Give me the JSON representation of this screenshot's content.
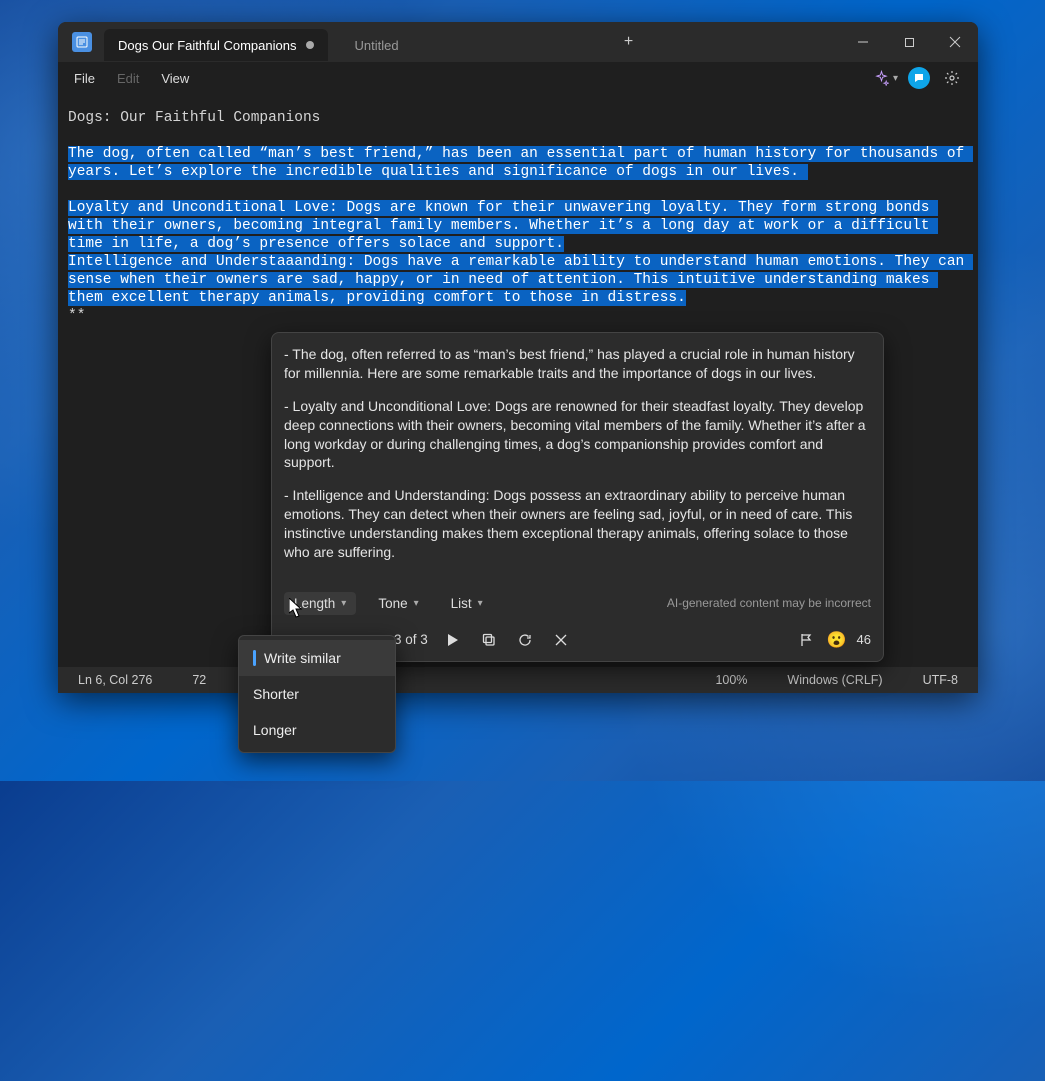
{
  "tabs": {
    "active": "Dogs Our Faithful Companions",
    "second": "Untitled"
  },
  "menu": {
    "file": "File",
    "edit": "Edit",
    "view": "View"
  },
  "document": {
    "title": "Dogs: Our Faithful Companions",
    "p1": "The dog, often called “man’s best friend,” has been an essential part of human history for thousands of years. Let’s explore the incredible qualities and significance of dogs in our lives.",
    "p2": "Loyalty and Unconditional Love: Dogs are known for their unwavering loyalty. They form strong bonds with their owners, becoming integral family members. Whether it’s a long day at work or a difficult time in life, a dog’s presence offers solace and support.",
    "p3": "Intelligence and Understaaanding: Dogs have a remarkable ability to understand human emotions. They can sense when their owners are sad, happy, or in need of attention. This intuitive understanding makes them excellent therapy animals, providing comfort to those in distress.",
    "stars": "**"
  },
  "ai": {
    "para1": "- The dog, often referred to as “man’s best friend,” has played a crucial role in human history for millennia. Here are some remarkable traits and the importance of dogs in our lives.",
    "para2": "- Loyalty and Unconditional Love: Dogs are renowned for their steadfast loyalty. They develop deep connections with their owners, becoming vital members of the family. Whether it’s after a long workday or during challenging times, a dog’s companionship provides comfort and support.",
    "para3": "- Intelligence and Understanding: Dogs possess an extraordinary ability to perceive human emotions. They can detect when their owners are feeling sad, joyful, or in need of care. This instinctive understanding makes them exceptional therapy animals, offering solace to those who are suffering.",
    "dd_length": "Length",
    "dd_tone": "Tone",
    "dd_list": "List",
    "note": "AI-generated content may be incorrect",
    "count": "3 of 3",
    "reactions": "46"
  },
  "length_menu": {
    "write_similar": "Write similar",
    "shorter": "Shorter",
    "longer": "Longer"
  },
  "status": {
    "pos": "Ln 6, Col 276",
    "chars": "72",
    "zoom": "100%",
    "eol": "Windows (CRLF)",
    "encoding": "UTF-8"
  }
}
